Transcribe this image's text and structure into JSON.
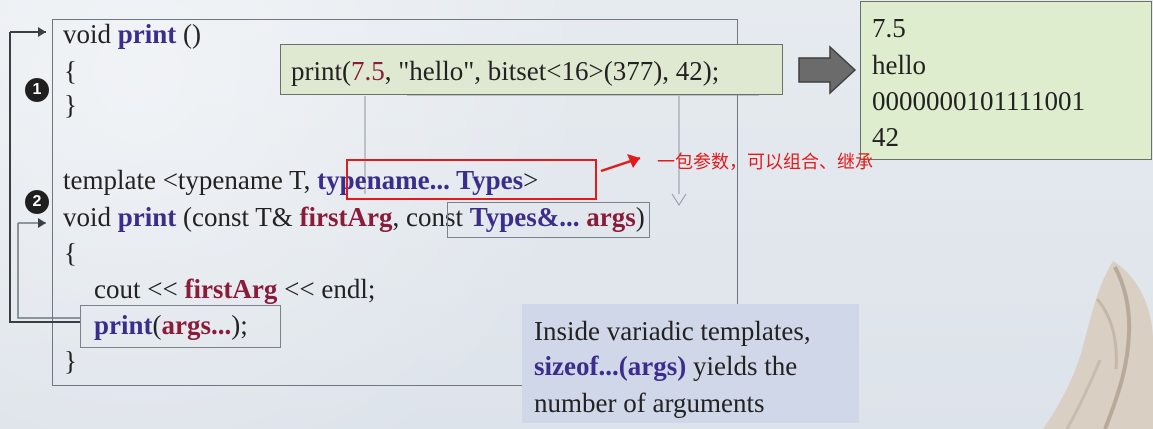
{
  "slide": {
    "markers": {
      "one": "1",
      "two": "2"
    },
    "code": {
      "line1_prefix": "void ",
      "line1_keyword": "print",
      "line1_suffix": " ()",
      "open_brace_1": "{",
      "close_brace_1": "}",
      "template_prefix": "template <typename T, ",
      "template_variadic": "typename... Types",
      "template_suffix": ">",
      "line2_prefix": "void ",
      "line2_keyword": "print",
      "line2_part1": " (const T& ",
      "line2_first_arg": "firstArg",
      "line2_comma": ", ",
      "line2_types_prefix": "const ",
      "line2_types_keyword": "Types&...",
      "line2_space": " ",
      "line2_args": "args",
      "line2_close": ")",
      "open_brace_2": "{",
      "cout_prefix": "cout << ",
      "cout_first_arg": "firstArg",
      "cout_suffix": " << endl;",
      "recursive_print": "print",
      "recursive_open": "(",
      "recursive_args": "args...",
      "recursive_close": ");",
      "close_brace_2": "}"
    },
    "call": {
      "prefix": "print(",
      "first": "7.5",
      "rest": ", \"hello\", bitset<16>(377), 42);"
    },
    "output": {
      "line1": "7.5",
      "line2": "hello",
      "line3": "0000000101111001",
      "line4": "42"
    },
    "annotation": "一包参数，可以组合、继承",
    "note": {
      "line1": "Inside variadic templates,",
      "line2_keyword": "sizeof...(args)",
      "line2_suffix": " yields the",
      "line3": "number of arguments"
    },
    "colors": {
      "print": "#3b2d8c",
      "variadic": "#8a1c3a",
      "annotation": "#e11b1b",
      "output_bg": "#dfedcf",
      "note_bg": "#cfd7e8"
    }
  }
}
